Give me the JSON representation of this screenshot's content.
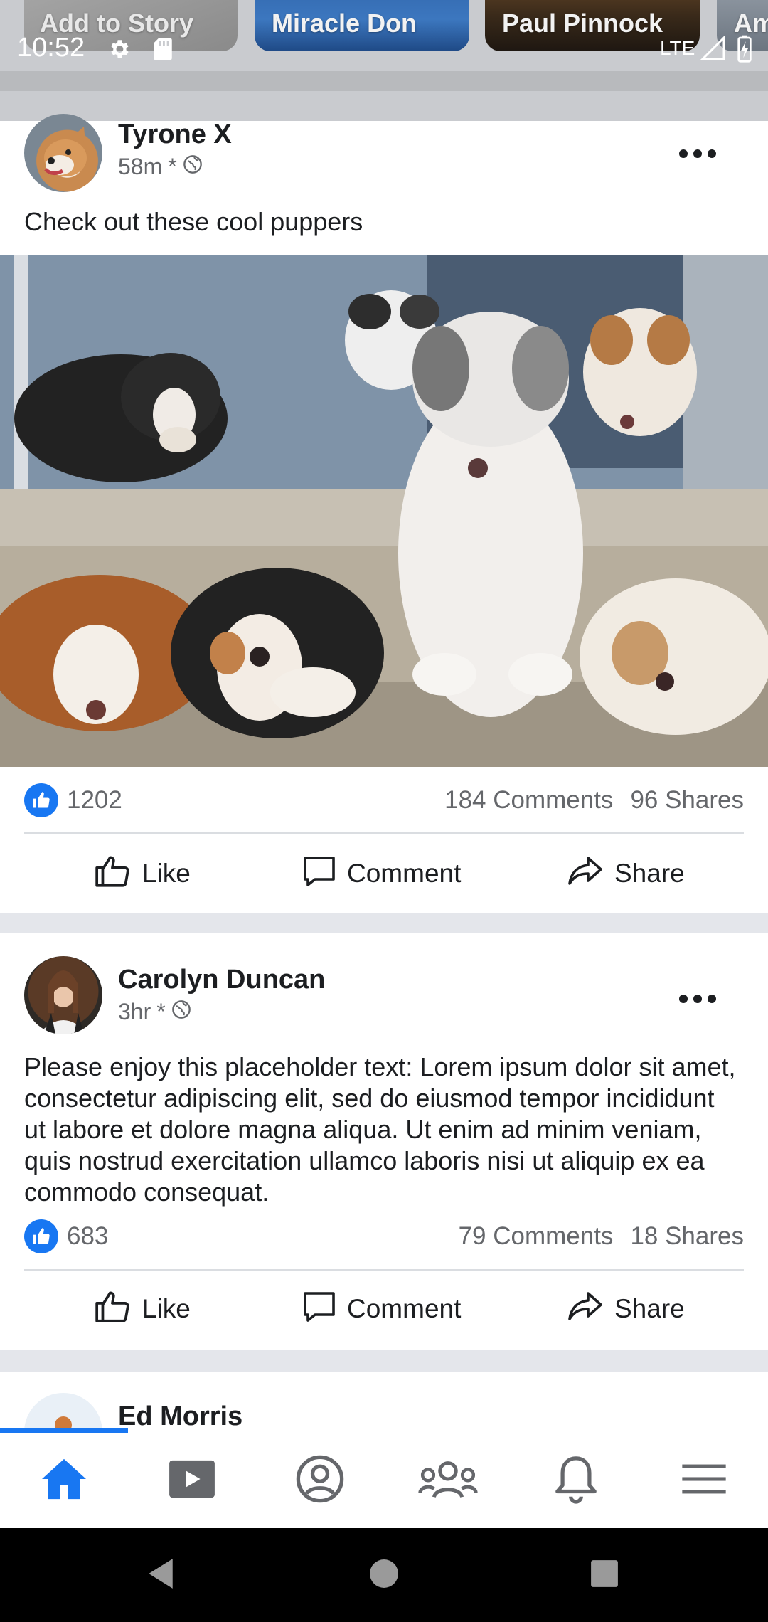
{
  "status_bar": {
    "time": "10:52",
    "network": "LTE",
    "icons": [
      "gear-icon",
      "sd-card-icon",
      "signal-icon",
      "battery-charging-icon"
    ]
  },
  "stories": [
    {
      "name": "Add to Story"
    },
    {
      "name": "Miracle Don"
    },
    {
      "name": "Paul Pinnock"
    },
    {
      "name": "Am"
    }
  ],
  "posts": [
    {
      "author": "Tyrone X",
      "time": "58m",
      "separator": "*",
      "visibility_icon": "globe-icon",
      "text": "Check out these cool puppers",
      "has_photo": true,
      "likes": "1202",
      "comments": "184 Comments",
      "shares": "96 Shares"
    },
    {
      "author": "Carolyn Duncan",
      "time": "3hr",
      "separator": "*",
      "visibility_icon": "globe-icon",
      "text": "Please enjoy this placeholder text: Lorem ipsum dolor sit amet, consectetur adipiscing elit, sed do eiusmod tempor incididunt ut labore et dolore magna aliqua. Ut enim ad minim veniam, quis nostrud exercitation ullamco laboris nisi ut aliquip ex ea commodo consequat.",
      "has_photo": false,
      "likes": "683",
      "comments": "79 Comments",
      "shares": "18 Shares"
    },
    {
      "author": "Ed Morris"
    }
  ],
  "actions": {
    "like": "Like",
    "comment": "Comment",
    "share": "Share"
  },
  "bottom_nav": {
    "items": [
      "home-icon",
      "video-icon",
      "profile-icon",
      "groups-icon",
      "notifications-icon",
      "menu-icon"
    ],
    "active": "home-icon",
    "accent_color": "#1877f2"
  },
  "system_nav": [
    "back-icon",
    "home-circle-icon",
    "recents-icon"
  ]
}
